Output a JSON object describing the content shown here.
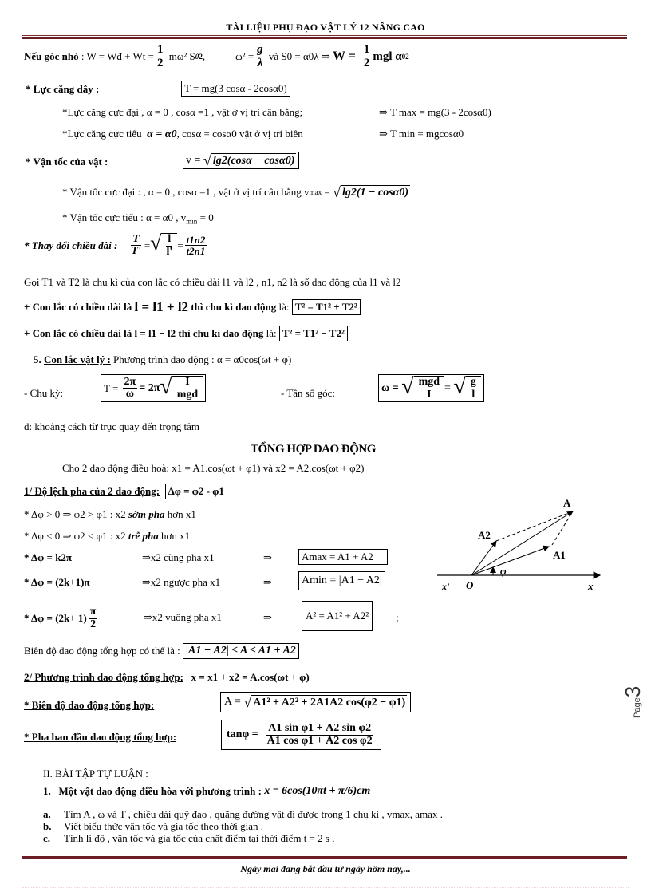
{
  "header": {
    "title": "TÀI LIỆU  PHỤ ĐẠO VẬT LÝ 12 NÂNG CAO"
  },
  "energy": {
    "label": "Nếu góc nhỏ",
    "expr1": ": W = Wđ + Wt =",
    "frac1_num": "1",
    "frac1_den": "2",
    "expr1b": "mω² S",
    "expr1b_sub": "0",
    "expr1b_sup": "2",
    "expr1c": ",",
    "omega_sq": "ω² =",
    "frac2_num": "g",
    "frac2_den": "λ",
    "and_s0": "và S0 = α0λ ⇒",
    "w_bold": "W  =",
    "frac3_num": "1",
    "frac3_den": "2",
    "tail": "mgl α",
    "tail_sub": "0",
    "tail_sup": "2"
  },
  "tension": {
    "title": "* Lực căng dây :",
    "formula": "T = mg(3 cosα - 2cosα0)",
    "max_text": "*Lực căng cực đại , α = 0 , cosα =1 , vật ở vị trí cân bằng;",
    "max_result": "⇒ T max = mg(3 - 2cosα0)",
    "min_text_a": "*Lực căng cực tiểu",
    "min_text_b": "α = α0",
    "min_text_c": ", cosα = cosα0 vật ở vị trí biên",
    "min_result": "⇒ T min = mgcosα0"
  },
  "velocity": {
    "title": "* Vận tốc của vật  :",
    "formula_lhs": "v =",
    "formula_rad": "lg2(cosα − cosα0)",
    "max_text": "* Vận tốc cực đại : , α = 0 , cosα =1 , vật ở vị trí cân bằng v",
    "max_sub": "max",
    "max_eq": "=",
    "max_rad": "lg2(1 − cosα0)",
    "min_text": "* Vận tốc cực tiểu : α = α0  , v",
    "min_sub": "min",
    "min_tail": "= 0"
  },
  "length_change": {
    "title": "*  Thay đổi chiều dài :",
    "f1_num": "T",
    "f1_den": "T'",
    "eq": "=",
    "f2_num": "l",
    "f2_den": "l'",
    "f3_num": "t1n2",
    "f3_den": "t2n1",
    "note": "Gọi T1 và T2 là chu kì của con lắc có chiều dài l1 và l2 , n1, n2 là số dao động của l1 và l2",
    "sum_text_a": "+  Con lắc có chiều dài là",
    "sum_len": "l = l1 + l2",
    "sum_text_b": "thì chu kì dao động",
    "sum_text_c": "là:",
    "sum_formula": "T² = T1² + T2²",
    "diff_text_a": "+  Con lắc có chiều dài là l = l1 − l2  thì chu kì dao động",
    "diff_text_c": "là:",
    "diff_formula": "T² = T1² − T2²"
  },
  "physical_pendulum": {
    "heading_num": "5.",
    "heading": "Con lắc vật lý :",
    "equation": "Phương trình dao động : α = α0cos(ωt + φ)",
    "period_label": "- Chu kỳ:",
    "period_lhs": "T =",
    "period_f_num": "2π",
    "period_f_den": "ω",
    "period_mid": "= 2π",
    "period_r_num": "I",
    "period_r_den": "mgd",
    "freq_label": "- Tần số góc:",
    "freq_lhs": "ω =",
    "freq_r1_num": "mgd",
    "freq_r1_den": "I",
    "freq_eq": "=",
    "freq_r2_num": "g",
    "freq_r2_den": "l",
    "note": "d: khoảng cách từ trục quay đến trọng tâm"
  },
  "synthesis": {
    "title": "TỔNG HỢP DAO ĐỘNG",
    "intro": "Cho 2 dao động điều hoà: x1 = A1.cos(ωt + φ1) và x2 =  A2.cos(ωt + φ2)",
    "phase_diff_heading": "1/ Độ lệch pha của 2 dao động:",
    "phase_diff_formula": "Δφ = φ2 - φ1",
    "lead_a": "* Δφ > 0 ⇒ φ2 > φ1   :  x2",
    "lead_b": "sớm pha",
    "lead_c": "hơn x1",
    "lag_a": "* Δφ < 0 ⇒ φ2 < φ1   :  x2",
    "lag_b": "trễ pha",
    "lag_c": "hơn x1",
    "cases": [
      {
        "cond": "* Δφ = k2π",
        "rel": "⇒x2 cùng pha x1",
        "arrow": "⇒",
        "result": "Amax = A1 + A2"
      },
      {
        "cond": "* Δφ = (2k+1)π",
        "rel": "⇒x2 ngược pha x1",
        "arrow": "⇒",
        "result": "Amin = |A1 − A2|"
      },
      {
        "cond": "* Δφ = (2k+ 1)",
        "cond_frac_num": "π",
        "cond_frac_den": "2",
        "rel": "⇒x2 vuông pha x1",
        "arrow": "⇒",
        "result": "A² = A1² + A2²",
        "suffix": ";"
      }
    ],
    "range_text": "Biên độ dao động tổng hợp có thể là :",
    "range_formula": "|A1 − A2| ≤ A ≤ A1 + A2",
    "eq_heading": "2/ Phương trình dao động tổng hợp:",
    "eq_formula": "x = x1 + x2 = A.cos(ωt + φ)",
    "amp_heading": "* Biên độ dao động tổng hợp:",
    "amp_lhs": "A =",
    "amp_rad": "A1² + A2² + 2A1A2 cos(φ2 − φ1)",
    "phase_heading": "* Pha ban đầu dao động tổng hợp:",
    "phase_lhs": "tanφ  =",
    "phase_num": "A1 sin φ1 + A2 sin φ2",
    "phase_den": "A1 cos φ1 + A2 cos φ2"
  },
  "diagram": {
    "labels": {
      "A": "A",
      "A1": "A1",
      "A2": "A2",
      "phi": "φ",
      "O": "O",
      "x_neg": "x'",
      "x": "x"
    }
  },
  "exercises": {
    "section": "II.  BÀI TẬP TỰ LUẬN :",
    "problem_num": "1.",
    "problem_text": "Một vật dao động điều hòa với phương trình :",
    "problem_formula": "x = 6cos(10πt + π/6)cm",
    "items": [
      {
        "label": "a.",
        "text": "Tìm A , ω và T , chiều dài quỹ đạo , quãng đường vật đi được trong 1 chu kì , vmax, amax ."
      },
      {
        "label": "b.",
        "text": "Viết biểu thức vận tốc và gia tốc theo thời gian ."
      },
      {
        "label": "c.",
        "text": "Tính li độ , vận tốc và gia tốc của chất điểm tại thời điểm t = 2 s ."
      }
    ]
  },
  "footer": {
    "quote": "Ngày mai đang bắt đầu từ ngày hôm nay,..."
  },
  "page": {
    "label": "Page",
    "number": "3"
  }
}
